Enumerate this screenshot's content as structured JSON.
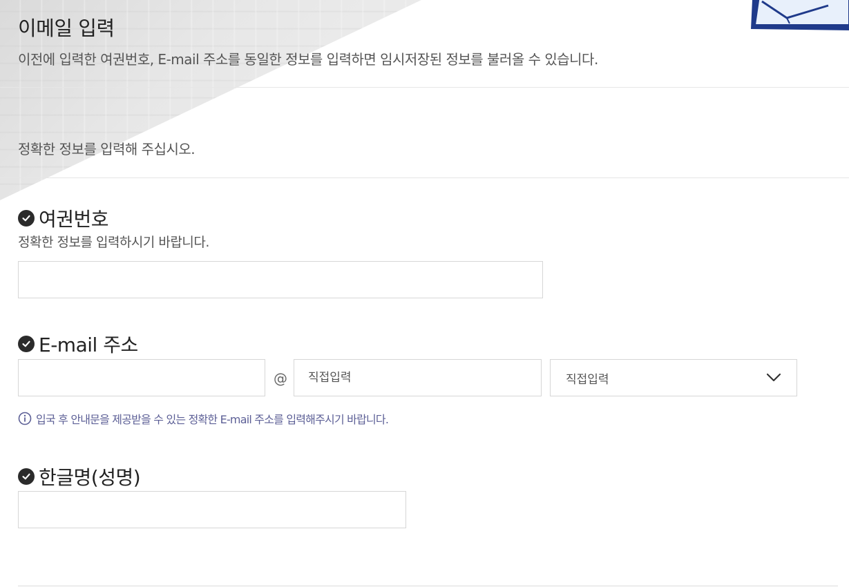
{
  "header": {
    "title": "이메일 입력",
    "description": "이전에 입력한 여권번호, E-mail 주소를 동일한 정보를 입력하면 임시저장된 정보를 불러올 수 있습니다."
  },
  "notice": "정확한 정보를 입력해 주십시오.",
  "passport": {
    "label": "여권번호",
    "help": "정확한 정보를 입력하시기 바랍니다.",
    "value": ""
  },
  "email": {
    "label": "E-mail 주소",
    "local_value": "",
    "at": "@",
    "domain_placeholder": "직접입력",
    "domain_select": {
      "selected": "직접입력"
    },
    "info": "입국 후 안내문을 제공받을 수 있는 정확한 E-mail 주소를 입력해주시기 바랍니다."
  },
  "korean_name": {
    "label": "한글명(성명)",
    "value": ""
  },
  "colors": {
    "info_text": "#5c5f96",
    "check_icon": "#2b2b2b",
    "border": "#d6d6d6"
  },
  "icons": [
    "check-circle-icon",
    "info-circle-icon",
    "chevron-down-icon"
  ]
}
